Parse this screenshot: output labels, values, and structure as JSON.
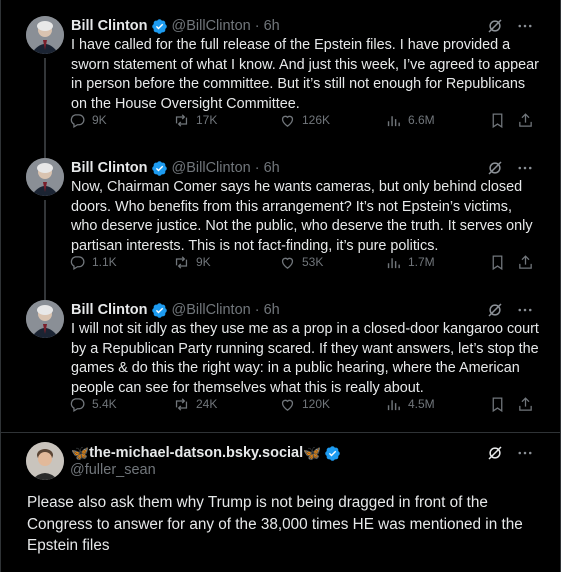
{
  "tweets": [
    {
      "author": "Bill Clinton",
      "handle": "@BillClinton",
      "time": "6h",
      "text": "I have called for the full release of the Epstein files. I have provided a sworn statement of what I know. And just this week, I’ve agreed to appear in person before the committee. But it’s still not enough for Republicans on the House Oversight Committee.",
      "replies": "9K",
      "reposts": "17K",
      "likes": "126K",
      "views": "6.6M"
    },
    {
      "author": "Bill Clinton",
      "handle": "@BillClinton",
      "time": "6h",
      "text": "Now, Chairman Comer says he wants cameras, but only behind closed doors. Who benefits from this arrangement? It’s not Epstein’s victims, who deserve justice. Not the public, who deserve the truth. It serves only partisan interests. This is not fact-finding, it’s pure politics.",
      "replies": "1.1K",
      "reposts": "9K",
      "likes": "53K",
      "views": "1.7M"
    },
    {
      "author": "Bill Clinton",
      "handle": "@BillClinton",
      "time": "6h",
      "text": "I will not sit idly as they use me as a prop in a closed-door kangaroo court by a Republican Party running scared. If they want answers, let’s stop the games & do this the right way: in a public hearing, where the American people can see for themselves what this is really about.",
      "replies": "5.4K",
      "reposts": "24K",
      "likes": "120K",
      "views": "4.5M"
    }
  ],
  "reply": {
    "name_prefix": "🦋",
    "name": "the-michael-datson.bsky.social",
    "name_suffix": "🦋",
    "handle": "@fuller_sean",
    "text": "Please also ask them why Trump is not being dragged in front of the Congress to answer for any of the 38,000 times HE was mentioned in the Epstein files"
  },
  "icons": {
    "grok": "grok-icon",
    "more": "more-icon",
    "reply": "reply-icon",
    "repost": "repost-icon",
    "like": "like-icon",
    "views": "views-icon",
    "bookmark": "bookmark-icon",
    "share": "share-icon",
    "verified": "verified-badge-icon"
  },
  "colors": {
    "background": "#000000",
    "text": "#e7e9ea",
    "muted": "#71767b",
    "verified": "#1d9bf0",
    "divider": "#2f3336"
  }
}
